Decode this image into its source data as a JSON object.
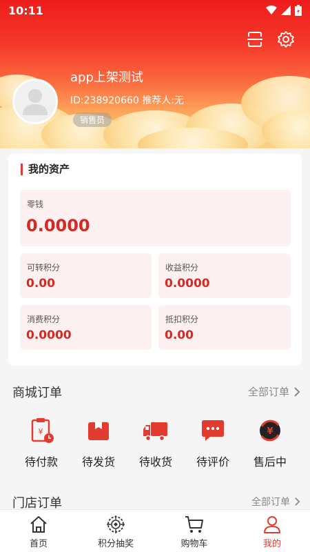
{
  "status": {
    "time": "10:11"
  },
  "user": {
    "name": "app上架测试",
    "id_line": "ID:238920660 推荐人:无",
    "role": "销售员"
  },
  "assets": {
    "title": "我的资产",
    "change": {
      "label": "零钱",
      "value": "0.0000"
    },
    "transferable_points": {
      "label": "可转积分",
      "value": "0.00"
    },
    "income_points": {
      "label": "收益积分",
      "value": "0.0000"
    },
    "consumption_points": {
      "label": "消费积分",
      "value": "0.0000"
    },
    "deduction_points": {
      "label": "抵扣积分",
      "value": "0.00"
    }
  },
  "mall_orders": {
    "title": "商城订单",
    "link": "全部订单",
    "items": [
      {
        "label": "待付款",
        "icon": "payment-pending-icon"
      },
      {
        "label": "待发货",
        "icon": "box-icon"
      },
      {
        "label": "待收货",
        "icon": "truck-icon"
      },
      {
        "label": "待评价",
        "icon": "chat-bubble-icon"
      },
      {
        "label": "售后中",
        "icon": "refund-icon"
      }
    ]
  },
  "store_orders": {
    "title": "门店订单",
    "link": "全部订单"
  },
  "tabbar": {
    "items": [
      {
        "label": "首页",
        "icon": "home-icon"
      },
      {
        "label": "积分抽奖",
        "icon": "lottery-icon"
      },
      {
        "label": "购物车",
        "icon": "cart-icon"
      },
      {
        "label": "我的",
        "icon": "profile-icon"
      }
    ]
  },
  "colors": {
    "accent": "#e23b30",
    "header_top": "#ee1c1c",
    "header_bottom": "#fcd486",
    "asset_bg": "#fdf0f0"
  }
}
